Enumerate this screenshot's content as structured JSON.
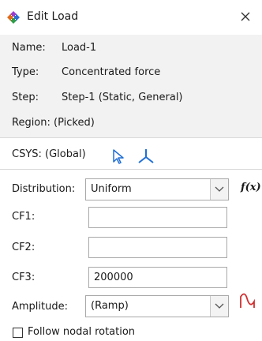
{
  "window": {
    "title": "Edit Load",
    "close_icon": "close-icon",
    "app_icon": "load-arrows-icon"
  },
  "info": {
    "name_label": "Name:",
    "name_value": "Load-1",
    "type_label": "Type:",
    "type_value": "Concentrated force",
    "step_label": "Step:",
    "step_value": "Step-1 (Static, General)",
    "region_label": "Region:",
    "region_value": "(Picked)"
  },
  "csys": {
    "text": "CSYS: (Global)",
    "pick_icon": "cursor-arrow-icon",
    "axes_icon": "axes-icon"
  },
  "distribution": {
    "label": "Distribution:",
    "value": "Uniform",
    "fx": "f(x)"
  },
  "cf1": {
    "label": "CF1:",
    "value": ""
  },
  "cf2": {
    "label": "CF2:",
    "value": ""
  },
  "cf3": {
    "label": "CF3:",
    "value": "200000"
  },
  "amplitude": {
    "label": "Amplitude:",
    "value": "(Ramp)",
    "icon": "amplitude-curve-icon"
  },
  "follow": {
    "label": "Follow nodal rotation",
    "checked": false
  },
  "colors": {
    "accent": "#1f6fd6",
    "info_bg": "#f2f2f2",
    "amp_icon": "#d03030"
  }
}
